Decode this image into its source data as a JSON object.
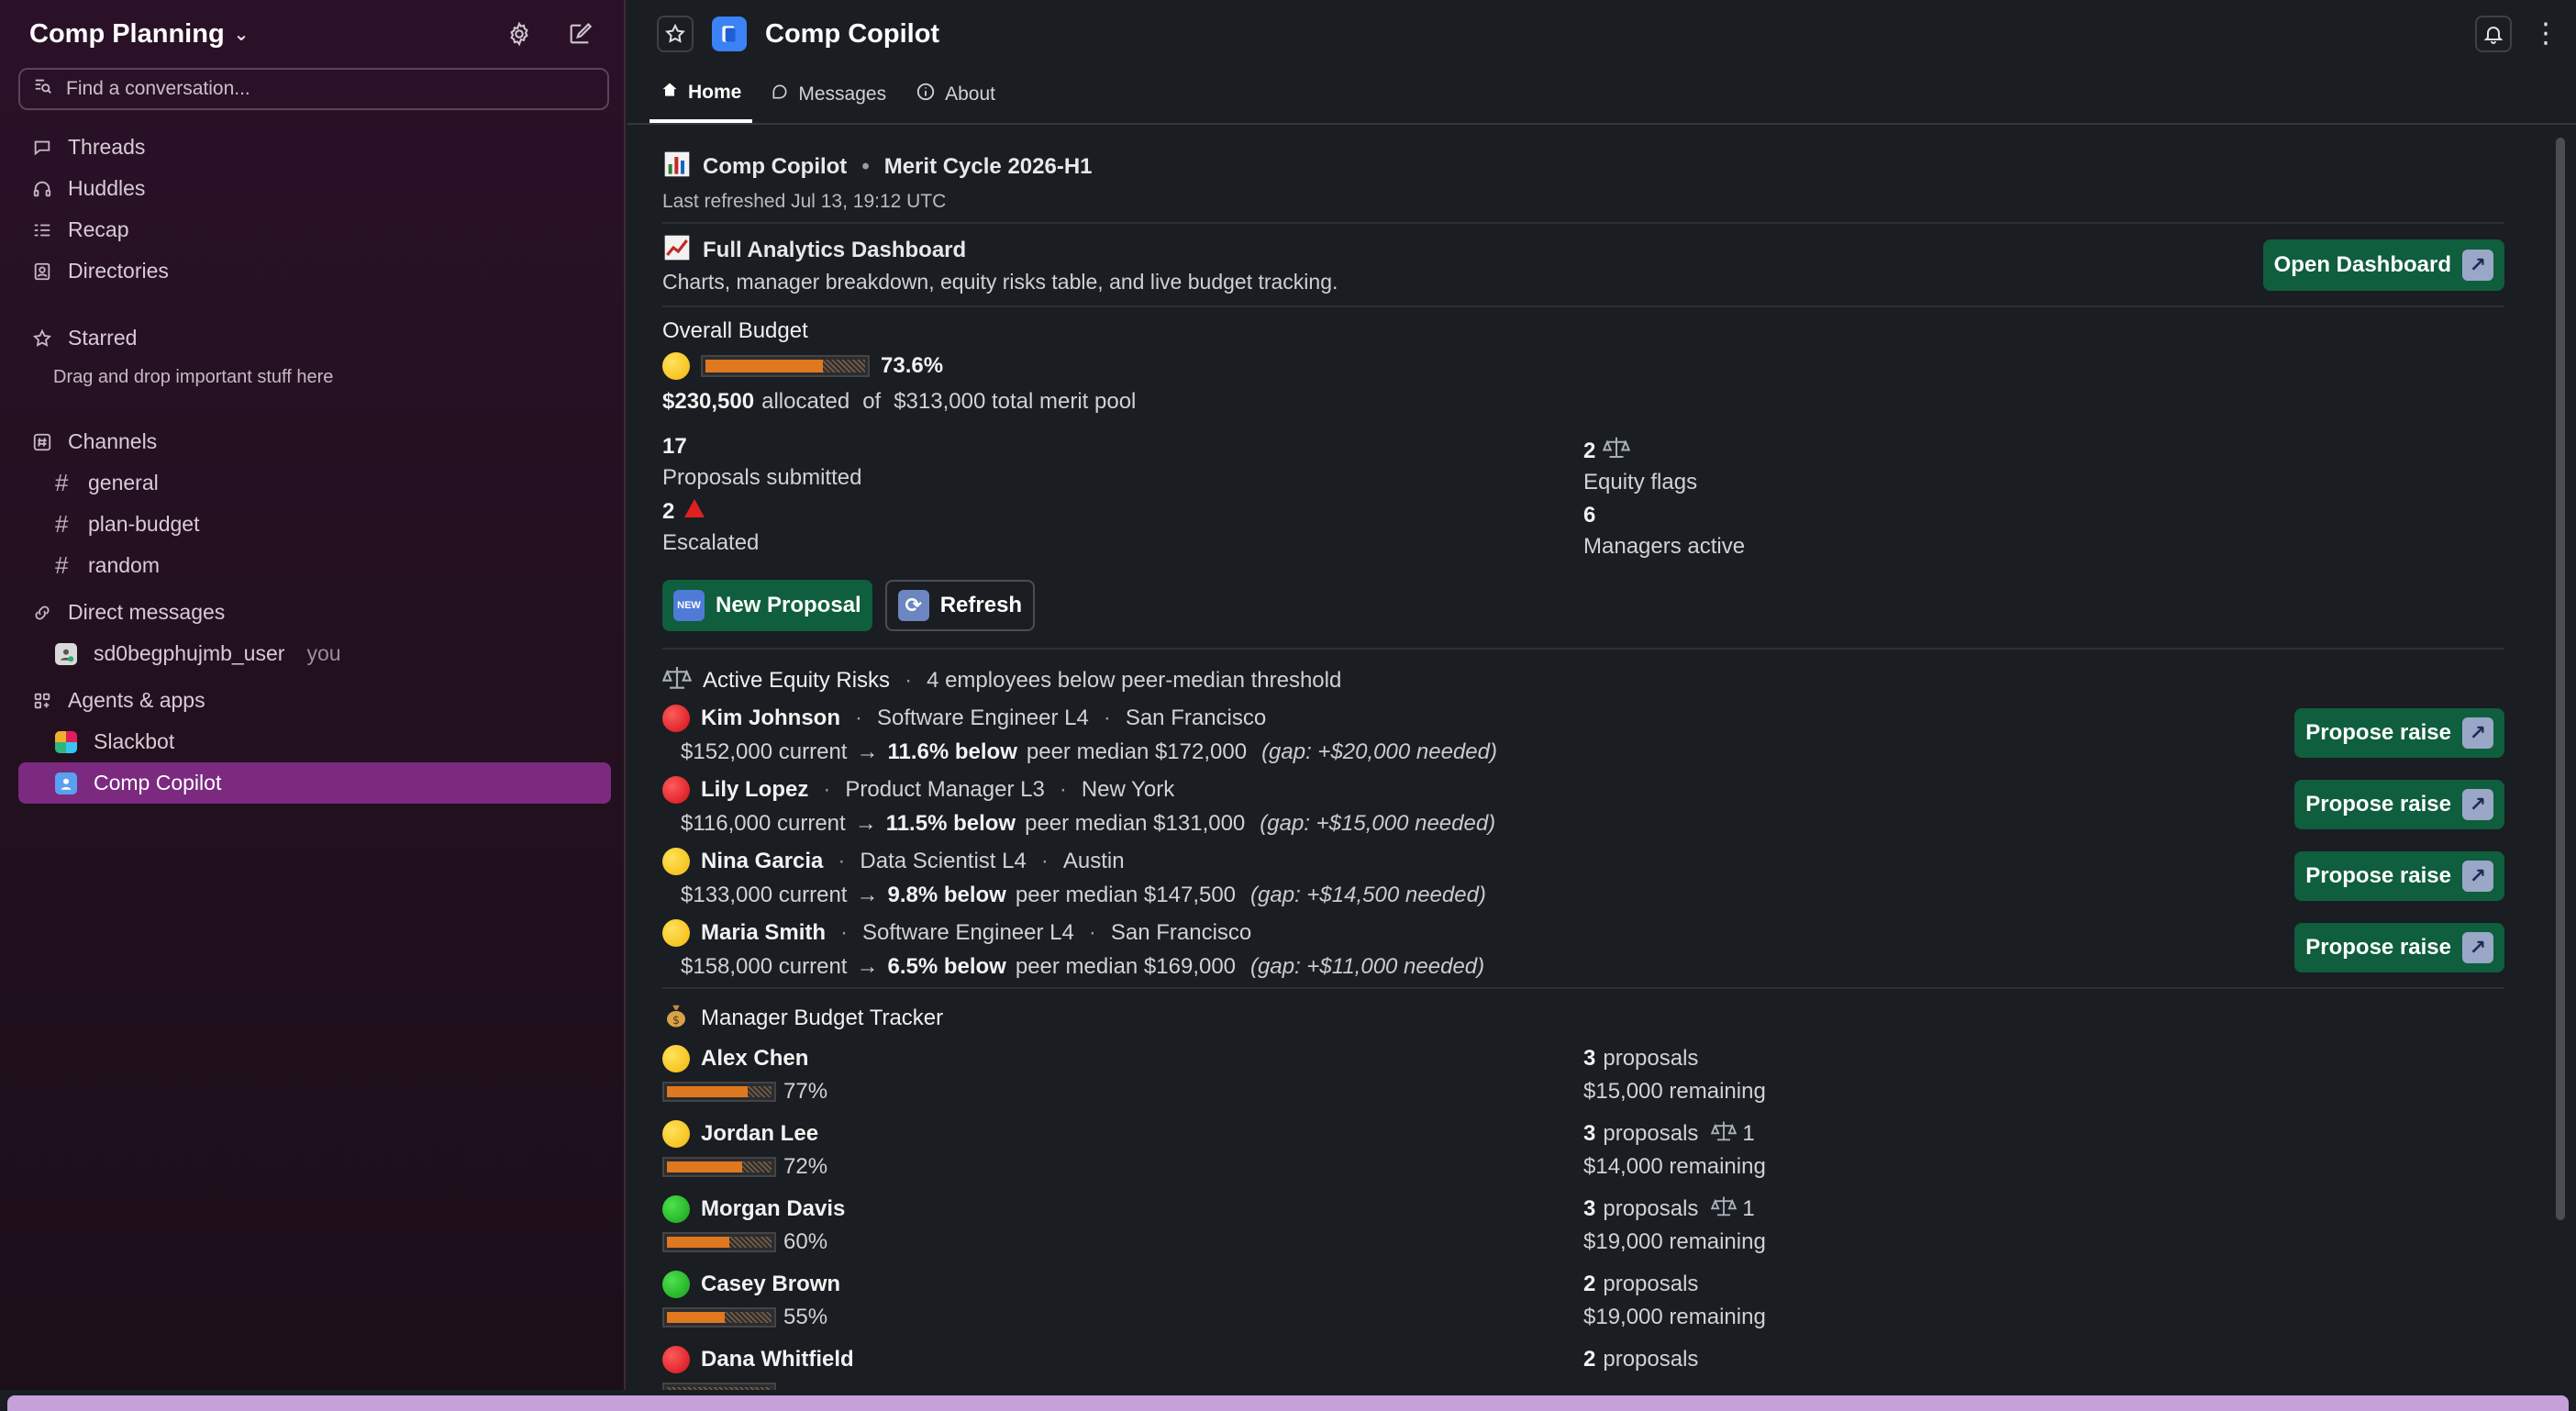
{
  "workspace": {
    "name": "Comp Planning"
  },
  "search": {
    "placeholder": "Find a conversation..."
  },
  "nav": [
    {
      "label": "Threads",
      "icon": "threads-icon"
    },
    {
      "label": "Huddles",
      "icon": "headphones-icon"
    },
    {
      "label": "Recap",
      "icon": "recap-icon"
    },
    {
      "label": "Directories",
      "icon": "directory-icon"
    }
  ],
  "starred": {
    "label": "Starred",
    "note": "Drag and drop important stuff here"
  },
  "channels": {
    "label": "Channels",
    "items": [
      "general",
      "plan-budget",
      "random"
    ]
  },
  "dms": {
    "label": "Direct messages",
    "user": "sd0begphujmb_user",
    "you": "you"
  },
  "apps": {
    "label": "Agents & apps",
    "items": [
      "Slackbot",
      "Comp Copilot"
    ]
  },
  "header": {
    "title": "Comp Copilot"
  },
  "tabs": [
    "Home",
    "Messages",
    "About"
  ],
  "home": {
    "title": "Comp Copilot",
    "cycle": "Merit Cycle 2026-H1",
    "refreshed": "Last refreshed Jul 13, 19:12 UTC",
    "dashboard": {
      "title": "Full Analytics Dashboard",
      "desc": "Charts, manager breakdown, equity risks table, and live budget tracking.",
      "button": "Open Dashboard"
    },
    "budget": {
      "label": "Overall Budget",
      "percent": "73.6%",
      "percent_value": 73.6,
      "allocated": "$230,500",
      "allocated_text": "allocated",
      "of": "of",
      "pool": "$313,000 total merit pool"
    },
    "stats": [
      {
        "value": "17",
        "label": "Proposals submitted"
      },
      {
        "value": "2",
        "label": "Equity flags"
      },
      {
        "value": "2",
        "label": "Escalated"
      },
      {
        "value": "6",
        "label": "Managers active"
      }
    ],
    "buttons": {
      "new_proposal": "New Proposal",
      "refresh": "Refresh"
    },
    "risks": {
      "title": "Active Equity Risks",
      "subtitle": "4 employees below peer-median threshold",
      "button": "Propose raise",
      "items": [
        {
          "name": "Kim Johnson",
          "role": "Software Engineer L4",
          "loc": "San Francisco",
          "current": "$152,000 current",
          "below": "11.6% below",
          "median": "peer median $172,000",
          "gap": "(gap: +$20,000 needed)",
          "level": "red"
        },
        {
          "name": "Lily Lopez",
          "role": "Product Manager L3",
          "loc": "New York",
          "current": "$116,000 current",
          "below": "11.5% below",
          "median": "peer median $131,000",
          "gap": "(gap: +$15,000 needed)",
          "level": "red"
        },
        {
          "name": "Nina Garcia",
          "role": "Data Scientist L4",
          "loc": "Austin",
          "current": "$133,000 current",
          "below": "9.8% below",
          "median": "peer median $147,500",
          "gap": "(gap: +$14,500 needed)",
          "level": "yellow"
        },
        {
          "name": "Maria Smith",
          "role": "Software Engineer L4",
          "loc": "San Francisco",
          "current": "$158,000 current",
          "below": "6.5% below",
          "median": "peer median $169,000",
          "gap": "(gap: +$11,000 needed)",
          "level": "yellow"
        }
      ]
    },
    "managers": {
      "title": "Manager Budget Tracker",
      "items": [
        {
          "name": "Alex Chen",
          "pct": "77%",
          "pct_value": 77,
          "count": "3",
          "proposals": "proposals",
          "flags": "",
          "remaining": "$15,000 remaining",
          "level": "yellow"
        },
        {
          "name": "Jordan Lee",
          "pct": "72%",
          "pct_value": 72,
          "count": "3",
          "proposals": "proposals",
          "flags": "1",
          "remaining": "$14,000 remaining",
          "level": "yellow"
        },
        {
          "name": "Morgan Davis",
          "pct": "60%",
          "pct_value": 60,
          "count": "3",
          "proposals": "proposals",
          "flags": "1",
          "remaining": "$19,000 remaining",
          "level": "green"
        },
        {
          "name": "Casey Brown",
          "pct": "55%",
          "pct_value": 55,
          "count": "2",
          "proposals": "proposals",
          "flags": "",
          "remaining": "$19,000 remaining",
          "level": "green"
        },
        {
          "name": "Dana Whitfield",
          "pct": "",
          "pct_value": 0,
          "count": "2",
          "proposals": "proposals",
          "flags": "",
          "remaining": "",
          "level": "red"
        }
      ]
    }
  }
}
